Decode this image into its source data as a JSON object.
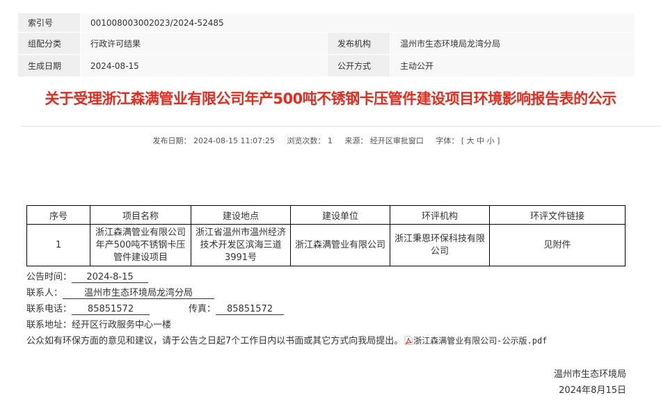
{
  "meta": {
    "index_label": "索引号",
    "index_value": "001008003002023/2024-52485",
    "category_label": "组配分类",
    "category_value": "行政许可结果",
    "publisher_label": "发布机构",
    "publisher_value": "温州市生态环境局龙湾分局",
    "date_label": "生成日期",
    "date_value": "2024-08-15",
    "disclosure_label": "公开方式",
    "disclosure_value": "主动公开"
  },
  "title": "关于受理浙江森满管业有限公司年产500吨不锈钢卡压管件建设项目环境影响报告表的公示",
  "info": {
    "publish_date": "发布日期：  2024-08-15 11:07:25",
    "views": "浏览次数：  1",
    "source": "来源：  经开区审批窗口",
    "font_label": "字体：",
    "font_open": "[",
    "font_large": "大",
    "font_medium": "中",
    "font_small": "小",
    "font_close": "]"
  },
  "table": {
    "headers": [
      "序号",
      "项目名称",
      "建设地点",
      "建设单位",
      "环评机构",
      "环评文件链接"
    ],
    "rows": [
      [
        "1",
        "浙江森满管业有限公司年产500吨不锈钢卡压管件建设项目",
        "浙江省温州市温州经济技术开发区滨海三道3991号",
        "浙江森满管业有限公司",
        "浙江秉恩环保科技有限公司",
        "见附件"
      ]
    ]
  },
  "notice": {
    "time_label": "公告时间：",
    "time_value": "2024-8-15",
    "contact_label": "联系人：",
    "contact_value": "温州市生态环境局龙湾分局",
    "phone_label": "联系电话：",
    "phone_value": "85851572",
    "fax_label": "传真：",
    "fax_value": "85851572",
    "address_label": "联系地址：",
    "address_value": "经开区行政服务中心一楼",
    "statement": "公众如有环保方面的意见和建议，请于公告之日起7个工作日内以书面或其它方式向我局提出。",
    "attachment": "浙江森满管业有限公司-公示版.pdf"
  },
  "signature": {
    "org": "温州市生态环境局",
    "date": "2024年8月15日"
  },
  "colors": {
    "title": "#e8291c",
    "label_bg": "#efefef",
    "value_bg": "#f8f8f8"
  }
}
